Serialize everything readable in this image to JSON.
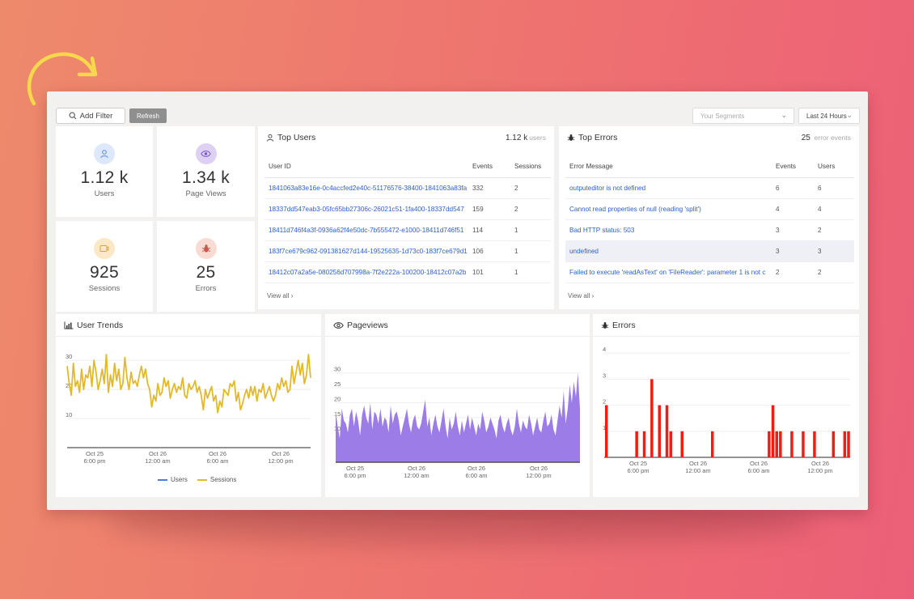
{
  "toolbar": {
    "add_filter": "Add Filter",
    "refresh": "Refresh",
    "segments_placeholder": "Your Segments",
    "time_range": "Last 24 Hours"
  },
  "stats": {
    "users": {
      "value": "1.12 k",
      "label": "Users",
      "color": "#5b8ee6",
      "bg": "#dde8fb",
      "icon": "user-icon"
    },
    "pageviews": {
      "value": "1.34 k",
      "label": "Page Views",
      "color": "#7b56c9",
      "bg": "#ddd0f3",
      "icon": "eye-icon"
    },
    "sessions": {
      "value": "925",
      "label": "Sessions",
      "color": "#d9a540",
      "bg": "#fbe8c6",
      "icon": "session-icon"
    },
    "errors": {
      "value": "25",
      "label": "Errors",
      "color": "#c65a4f",
      "bg": "#f8dcd3",
      "icon": "bug-icon"
    }
  },
  "top_users": {
    "title": "Top Users",
    "count": "1.12 k",
    "count_unit": "users",
    "columns": [
      "User ID",
      "Events",
      "Sessions"
    ],
    "rows": [
      {
        "id": "1841063a83e16e-0c4accfed2e40c-51176576-38400-1841063a83fa",
        "events": "332",
        "sessions": "2"
      },
      {
        "id": "18337dd547eab3-05fc65bb27306c-26021c51-1fa400-18337dd547",
        "events": "159",
        "sessions": "2"
      },
      {
        "id": "18411d746f4a3f-0936a62f4e50dc-7b555472-e1000-18411d746f51",
        "events": "114",
        "sessions": "1"
      },
      {
        "id": "183f7ce679c962-091381627d144-19525635-1d73c0-183f7ce679d1",
        "events": "106",
        "sessions": "1"
      },
      {
        "id": "18412c07a2a5e-080256d707998a-7f2e222a-100200-18412c07a2b",
        "events": "101",
        "sessions": "1"
      }
    ],
    "view_all": "View all"
  },
  "top_errors": {
    "title": "Top Errors",
    "count": "25",
    "count_unit": "error events",
    "columns": [
      "Error Message",
      "Events",
      "Users"
    ],
    "rows": [
      {
        "msg": "outputeditor is not defined",
        "events": "6",
        "users": "6"
      },
      {
        "msg": "Cannot read properties of null (reading 'split')",
        "events": "4",
        "users": "4"
      },
      {
        "msg": "Bad HTTP status: 503",
        "events": "3",
        "users": "2"
      },
      {
        "msg": "undefined",
        "events": "3",
        "users": "3"
      },
      {
        "msg": "Failed to execute 'readAsText' on 'FileReader': parameter 1 is not c",
        "events": "2",
        "users": "2"
      }
    ],
    "view_all": "View all"
  },
  "charts": {
    "user_trends_title": "User Trends",
    "pageviews_title": "Pageviews",
    "errors_title": "Errors",
    "legend_users": "Users",
    "legend_sessions": "Sessions",
    "users_color": "#4a7fd8",
    "sessions_color": "#e3b92c",
    "pageviews_color": "#9c7ce6",
    "errors_color": "#f21d12"
  },
  "chart_data": [
    {
      "type": "line",
      "title": "User Trends",
      "x_ticks": [
        [
          "Oct 25",
          "6:00 pm"
        ],
        [
          "Oct 26",
          "12:00 am"
        ],
        [
          "Oct 26",
          "6:00 am"
        ],
        [
          "Oct 26",
          "12:00 pm"
        ]
      ],
      "y_ticks": [
        "30",
        "20",
        "10"
      ],
      "ylim": [
        0,
        32
      ],
      "series": [
        {
          "name": "Users",
          "values": []
        },
        {
          "name": "Sessions",
          "values": [
            20,
            14,
            10,
            21,
            13,
            15,
            11,
            19,
            12,
            17,
            16,
            20,
            13,
            22,
            18,
            12,
            15,
            19,
            14,
            24,
            11,
            17,
            13,
            21,
            15,
            19,
            12,
            14,
            23,
            16,
            12,
            18,
            14,
            15,
            13,
            17,
            20,
            16,
            19,
            14,
            12,
            6,
            10,
            8,
            14,
            10,
            11,
            16,
            13,
            15,
            9,
            12,
            14,
            11,
            13,
            12,
            16,
            10,
            9,
            14,
            12,
            13,
            15,
            11,
            13,
            10,
            5,
            12,
            9,
            11,
            13,
            8,
            10,
            4,
            8,
            6,
            12,
            11,
            10,
            14,
            13,
            15,
            8,
            11,
            5,
            7,
            10,
            12,
            9,
            13,
            10,
            13,
            8,
            12,
            11,
            14,
            9,
            11,
            13,
            10,
            8,
            10,
            14,
            12,
            16,
            13,
            15,
            11,
            12,
            20,
            14,
            18,
            22,
            17,
            21,
            14,
            17,
            24,
            16
          ]
        }
      ]
    },
    {
      "type": "area",
      "title": "Pageviews",
      "x_ticks": [
        [
          "Oct 25",
          "6:00 pm"
        ],
        [
          "Oct 26",
          "12:00 am"
        ],
        [
          "Oct 26",
          "6:00 am"
        ],
        [
          "Oct 26",
          "12:00 pm"
        ]
      ],
      "y_ticks": [
        "30",
        "25",
        "20",
        "15",
        "10"
      ],
      "ylim": [
        0,
        34
      ],
      "values": [
        17,
        12,
        8,
        18,
        14,
        13,
        10,
        16,
        18,
        12,
        17,
        14,
        9,
        16,
        19,
        15,
        13,
        20,
        11,
        17,
        16,
        13,
        18,
        12,
        15,
        14,
        10,
        19,
        13,
        16,
        17,
        14,
        9,
        12,
        15,
        18,
        13,
        10,
        14,
        16,
        12,
        11,
        13,
        17,
        21,
        12,
        15,
        9,
        13,
        16,
        12,
        10,
        14,
        18,
        12,
        8,
        15,
        11,
        13,
        17,
        12,
        9,
        14,
        10,
        13,
        16,
        11,
        15,
        12,
        9,
        13,
        11,
        17,
        14,
        10,
        12,
        15,
        13,
        11,
        8,
        14,
        16,
        12,
        10,
        13,
        15,
        11,
        9,
        12,
        18,
        13,
        10,
        14,
        12,
        11,
        16,
        13,
        9,
        12,
        15,
        11,
        10,
        14,
        17,
        12,
        13,
        16,
        11,
        9,
        14,
        19,
        15,
        24,
        13,
        18,
        26,
        20,
        27,
        22,
        30,
        18
      ]
    },
    {
      "type": "bar",
      "title": "Errors",
      "x_ticks": [
        [
          "Oct 25",
          "6:00 pm"
        ],
        [
          "Oct 26",
          "12:00 am"
        ],
        [
          "Oct 26",
          "6:00 am"
        ],
        [
          "Oct 26",
          "12:00 pm"
        ]
      ],
      "y_ticks": [
        "4",
        "3",
        "2",
        "1"
      ],
      "ylim": [
        0,
        4
      ],
      "values": [
        2,
        0,
        0,
        0,
        0,
        0,
        0,
        0,
        1,
        0,
        1,
        0,
        3,
        0,
        2,
        0,
        2,
        1,
        0,
        0,
        1,
        0,
        0,
        0,
        0,
        0,
        0,
        0,
        1,
        0,
        0,
        0,
        0,
        0,
        0,
        0,
        0,
        0,
        0,
        0,
        0,
        0,
        0,
        1,
        2,
        1,
        1,
        0,
        0,
        1,
        0,
        0,
        1,
        0,
        0,
        1,
        0,
        0,
        0,
        0,
        1,
        0,
        0,
        1,
        1
      ]
    }
  ]
}
